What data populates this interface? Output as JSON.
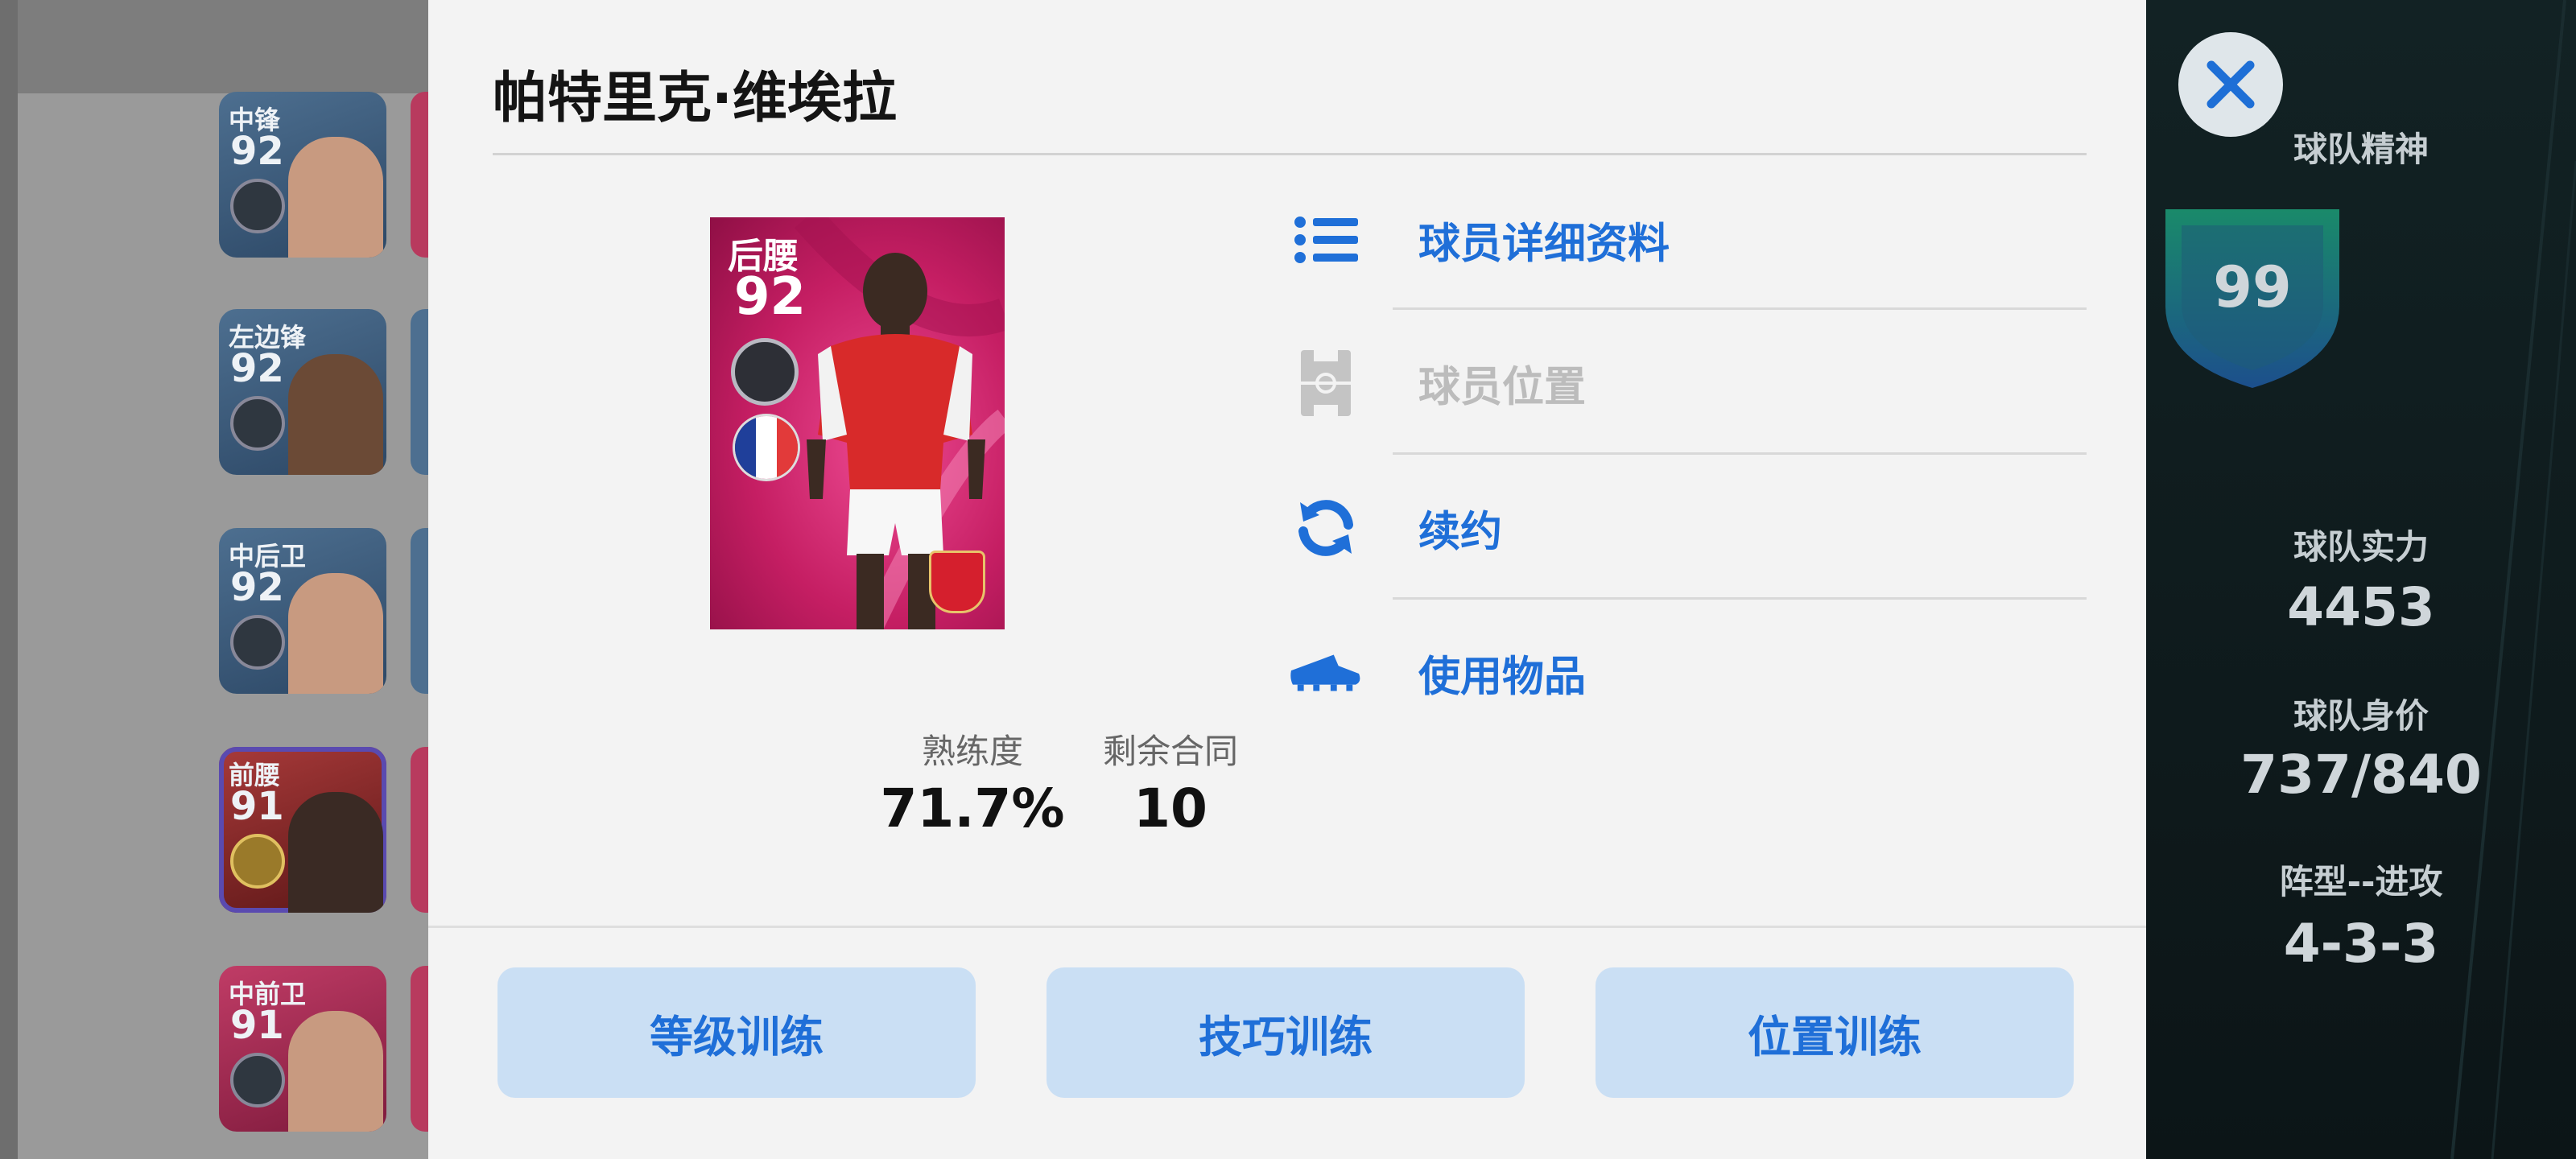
{
  "dialog": {
    "title": "帕特里克·维埃拉",
    "card": {
      "position": "后腰",
      "rating": "92",
      "nationality_flag": "france-flag",
      "club_badge": "arsenal-badge"
    },
    "stats": [
      {
        "label": "熟练度",
        "value": "71.7%"
      },
      {
        "label": "剩余合同",
        "value": "10"
      }
    ],
    "menu": [
      {
        "label": "球员详细资料",
        "icon": "list-icon",
        "enabled": true
      },
      {
        "label": "球员位置",
        "icon": "pitch-icon",
        "enabled": false
      },
      {
        "label": "续约",
        "icon": "refresh-icon",
        "enabled": true
      },
      {
        "label": "使用物品",
        "icon": "boot-icon",
        "enabled": true
      }
    ],
    "buttons": [
      "等级训练",
      "技巧训练",
      "位置训练"
    ]
  },
  "background_left": {
    "cards": [
      {
        "position": "中锋",
        "rating": "92"
      },
      {
        "position": "左边锋",
        "rating": "92"
      },
      {
        "position": "中后卫",
        "rating": "92"
      },
      {
        "position": "前腰",
        "rating": "91"
      },
      {
        "position": "中前卫",
        "rating": "91"
      }
    ]
  },
  "background_right": {
    "team_spirit_label": "球队精神",
    "team_spirit_value": "99",
    "strength_label": "球队实力",
    "strength_value": "4453",
    "value_label": "球队身价",
    "value_value": "737/840",
    "formation_label": "阵型--进攻",
    "formation_value": "4-3-3"
  },
  "colors": {
    "accent": "#1f6fd8",
    "dialog_bg": "#f3f3f3",
    "button_bg": "#cadff4",
    "card_pink": "#c51e63"
  }
}
